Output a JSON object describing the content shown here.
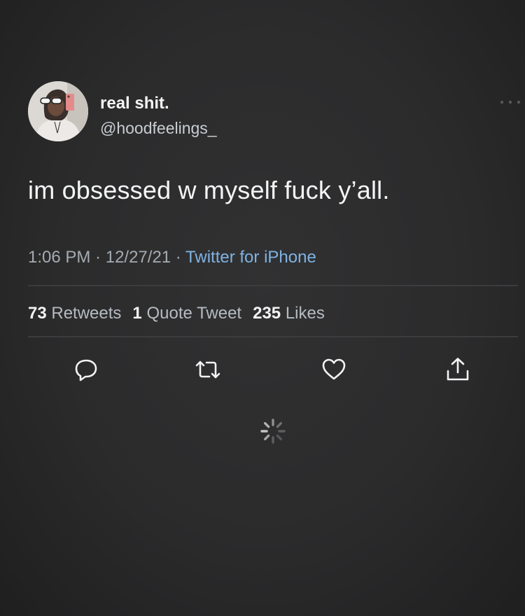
{
  "author": {
    "display_name": "real shit.",
    "handle": "@hoodfeelings_"
  },
  "tweet": {
    "text": "im obsessed w myself fuck y’all.",
    "time": "1:06 PM",
    "date": "12/27/21",
    "source": "Twitter for iPhone",
    "separator": " · "
  },
  "stats": {
    "retweets_count": "73",
    "retweets_label": "Retweets",
    "quotes_count": "1",
    "quotes_label": "Quote Tweet",
    "likes_count": "235",
    "likes_label": "Likes"
  },
  "actions": [
    {
      "name": "reply",
      "icon": "speech-bubble-icon"
    },
    {
      "name": "retweet",
      "icon": "retweet-arrows-icon"
    },
    {
      "name": "like",
      "icon": "heart-icon"
    },
    {
      "name": "share",
      "icon": "share-upload-icon"
    }
  ],
  "colors": {
    "background": "#2c2c2d",
    "text_primary": "#f4f5f6",
    "text_secondary": "#a5abb1",
    "link": "#7fb2e2",
    "divider": "#3b3c3e"
  },
  "loading_indicator": "spinner-icon"
}
